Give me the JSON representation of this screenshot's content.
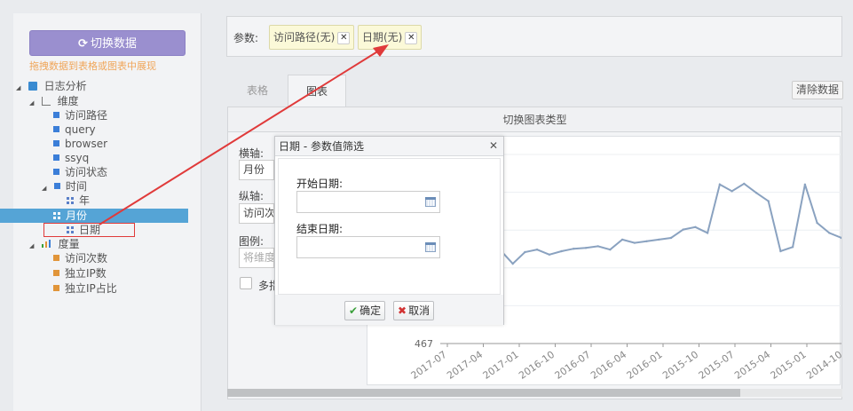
{
  "sidebar": {
    "switch_button": "切换数据",
    "switch_icon": "refresh-icon",
    "hint": "拖拽数据到表格或图表中展现",
    "tree": {
      "root": "日志分析",
      "dimension": "维度",
      "dimension_items": [
        "访问路径",
        "query",
        "browser",
        "ssyq",
        "访问状态"
      ],
      "time": "时间",
      "time_items": [
        "年",
        "月份",
        "日期"
      ],
      "measure": "度量",
      "measure_items": [
        "访问次数",
        "独立IP数",
        "独立IP占比"
      ]
    }
  },
  "params": {
    "label": "参数:",
    "chips": [
      "访问路径(无)",
      "日期(无)"
    ]
  },
  "tabs": [
    "表格",
    "图表"
  ],
  "clear_button": "清除数据",
  "chart_type_bar": "切换图表类型",
  "fields": {
    "x_label": "横轴:",
    "x_value": "月份",
    "y_label": "纵轴:",
    "y_value": "访问次",
    "legend_label": "图例:",
    "legend_placeholder": "将维度",
    "multi_label": "多指"
  },
  "dialog": {
    "title": "日期 - 参数值筛选",
    "start_label": "开始日期:",
    "end_label": "结束日期:",
    "ok": "确定",
    "cancel": "取消"
  },
  "chart_data": {
    "type": "line",
    "y_axis_min_label": "467",
    "x": [
      "2017-07",
      "2017-04",
      "2017-01",
      "2016-10",
      "2016-07",
      "2016-04",
      "2016-01",
      "2015-10",
      "2015-07",
      "2015-04",
      "2015-01",
      "2014-10"
    ],
    "series": [
      {
        "values": [
          1025,
          945,
          1015,
          1030,
          1000,
          1020,
          1035,
          1040,
          1050,
          1030,
          1090,
          1070,
          1080,
          1090,
          1100,
          1150,
          1165,
          1130,
          1420,
          1380,
          1425,
          1370,
          1320,
          1020,
          1045,
          1420,
          1190,
          1130,
          1100
        ]
      }
    ],
    "line_color": "#8aa2c0"
  },
  "colors": {
    "switch_button": "#9a8fcf",
    "selected_row": "#55a4d6",
    "chip_bg": "#fbf9d8",
    "annotation": "#e03a3a"
  }
}
